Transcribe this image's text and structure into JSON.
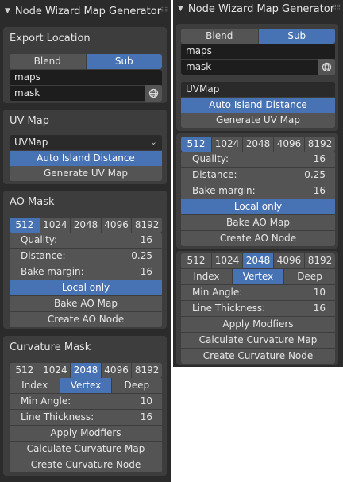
{
  "panel_title": "Node Wizard Map Generator",
  "export": {
    "heading": "Export Location",
    "tabs": [
      "Blend",
      "Sub"
    ],
    "selected_tab": "Sub",
    "folder_value": "maps",
    "name_value": "mask",
    "browse_icon": "globe-icon"
  },
  "uvmap": {
    "heading": "UV Map",
    "dropdown_value": "UVMap",
    "auto_island_label": "Auto Island Distance",
    "generate_label": "Generate UV Map"
  },
  "ao": {
    "heading": "AO Mask",
    "resolutions": [
      "512",
      "1024",
      "2048",
      "4096",
      "8192"
    ],
    "selected_resolution": "512",
    "quality_label": "Quality:",
    "quality_value": "16",
    "distance_label": "Distance:",
    "distance_value": "0.25",
    "margin_label": "Bake margin:",
    "margin_value": "16",
    "local_only_label": "Local only",
    "bake_label": "Bake AO Map",
    "create_label": "Create AO Node"
  },
  "curvature": {
    "heading": "Curvature Mask",
    "resolutions": [
      "512",
      "1024",
      "2048",
      "4096",
      "8192"
    ],
    "selected_resolution": "2048",
    "modes": [
      "Index",
      "Vertex",
      "Deep"
    ],
    "selected_mode": "Vertex",
    "min_angle_label": "Min Angle:",
    "min_angle_value": "10",
    "line_thickness_label": "Line Thickness:",
    "line_thickness_value": "16",
    "apply_label": "Apply Modfiers",
    "calculate_label": "Calculate Curvature Map",
    "create_label": "Create Curvature Node"
  },
  "colors": {
    "accent": "#4772b3",
    "panel_bg": "#2b2b2b",
    "section_bg": "#3d3d3d",
    "button_bg": "#545454",
    "field_bg": "#1d1d1d"
  }
}
